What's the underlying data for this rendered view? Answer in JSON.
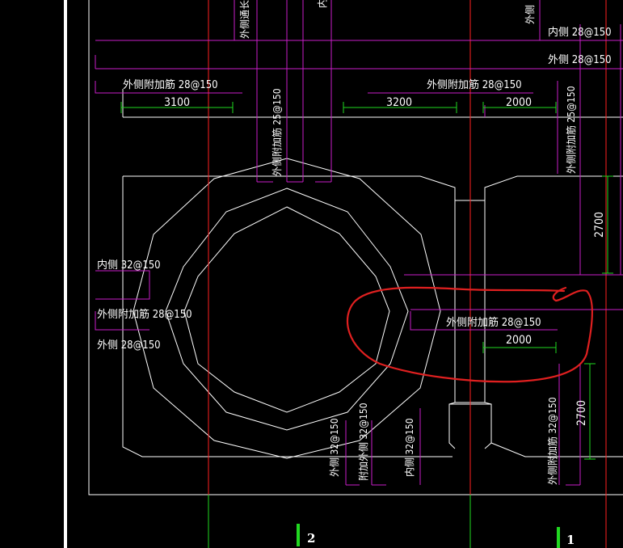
{
  "canvas": {
    "background": "#000000",
    "colors": {
      "white": "#ffffff",
      "magenta": "#c81ec8",
      "red": "#ff2020",
      "green": "#21d821",
      "markup": "#e02020"
    }
  },
  "grid_markers": [
    {
      "id": "2",
      "label": "2"
    },
    {
      "id": "1",
      "label": "1"
    }
  ],
  "rebar_labels": {
    "top_left_vertical": "外侧通长",
    "top_mid_vertical": "内",
    "top_right_vertical": "外侧",
    "top_right_1": "内侧 28@150",
    "top_right_2": "外侧 28@150",
    "upper_left": "外侧附加筋 28@150",
    "upper_mid": "外侧附加筋 28@150",
    "upper_vertical_center": "外侧附加筋 25@150",
    "upper_vertical_right": "外侧附加筋 25@150",
    "left_inner": "内侧 32@150",
    "left_outer_add": "外侧附加筋 28@150",
    "left_outer": "外侧 28@150",
    "right_add": "外侧附加筋 28@150",
    "bottom_v1": "外侧 32@150",
    "bottom_v2": "附加外侧 32@150",
    "bottom_v3": "内侧 32@150",
    "bottom_v4": "外侧附加筋 32@150"
  },
  "dimensions": {
    "d3100": "3100",
    "d3200": "3200",
    "d2000_top": "2000",
    "d2700_top": "2700",
    "d2000_mid": "2000",
    "d2700_bottom": "2700"
  }
}
